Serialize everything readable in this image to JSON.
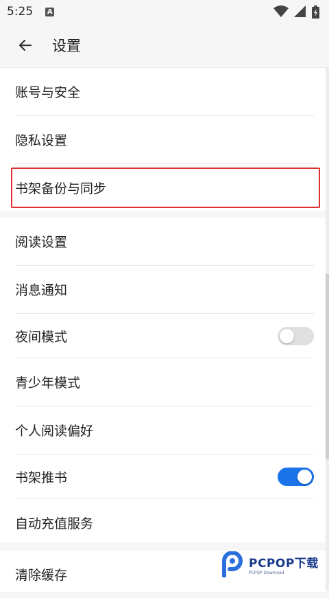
{
  "status": {
    "time": "5:25",
    "notification_letter": "A"
  },
  "toolbar": {
    "title": "设置"
  },
  "groups": [
    {
      "items": [
        {
          "label": "账号与安全"
        },
        {
          "label": "隐私设置"
        },
        {
          "label": "书架备份与同步"
        }
      ]
    },
    {
      "items": [
        {
          "label": "阅读设置"
        },
        {
          "label": "消息通知"
        },
        {
          "label": "夜间模式",
          "toggle": false
        },
        {
          "label": "青少年模式"
        },
        {
          "label": "个人阅读偏好"
        },
        {
          "label": "书架推书",
          "toggle": true
        },
        {
          "label": "自动充值服务"
        }
      ]
    },
    {
      "items": [
        {
          "label": "清除缓存"
        }
      ]
    }
  ],
  "colors": {
    "accent": "#1a73e8",
    "highlight": "#e03030"
  },
  "watermark": {
    "brand": "PCPOP下载",
    "sub": "PCPOP Download"
  }
}
